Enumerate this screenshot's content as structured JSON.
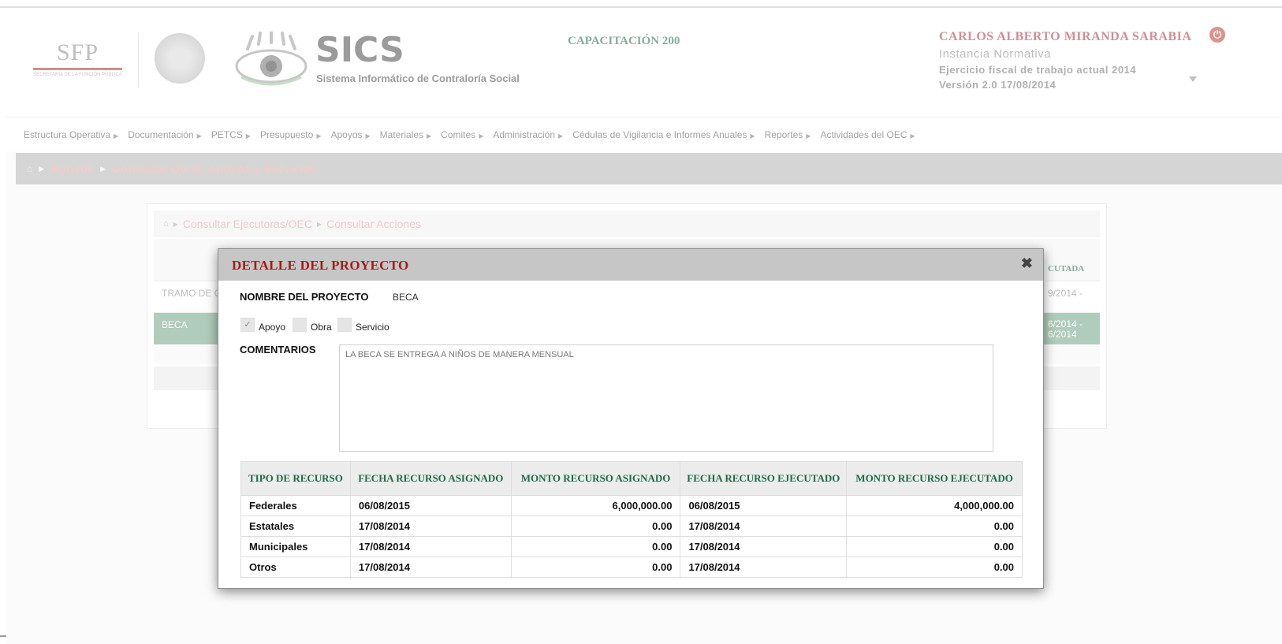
{
  "header": {
    "sfp_logo_text": "SFP",
    "sfp_logo_sub": "SECRETARÍA DE LA FUNCIÓN PÚBLICA",
    "app_name": "SICS",
    "app_subtitle": "Sistema Informático de Contraloría Social",
    "center_title": "CAPACITACIÓN 200",
    "user_name": "CARLOS ALBERTO MIRANDA SARABIA",
    "user_role": "Instancia Normativa",
    "fiscal_year": "Ejercicio fiscal de trabajo actual 2014",
    "version": "Versión 2.0    17/08/2014"
  },
  "nav": {
    "items": [
      "Estructura Operativa",
      "Documentación",
      "PETCS",
      "Presupuesto",
      "Apoyos",
      "Materiales",
      "Comites",
      "Administración",
      "Cédulas de Vigilancia e Informes Anuales",
      "Reportes",
      "Actividades del OEC"
    ]
  },
  "page_breadcrumb": [
    "Apoyos",
    "Consultar Obras Apoyos y Servicios"
  ],
  "card": {
    "breadcrumb": [
      "Consultar Ejecutoras/OEC",
      "Consultar Acciones"
    ],
    "partial_header": "CUTADA",
    "rows": [
      {
        "name": "TRAMO DE C",
        "date": "9/2014 -"
      },
      {
        "name": "BECA",
        "date": "6/2014 -",
        "date2": "6/2014"
      }
    ]
  },
  "modal": {
    "title": "DETALLE DEL PROYECTO",
    "project_name_label": "NOMBRE DEL PROYECTO",
    "project_name_value": "BECA",
    "checkboxes": [
      {
        "label": "Apoyo",
        "checked": true
      },
      {
        "label": "Obra",
        "checked": false
      },
      {
        "label": "Servicio",
        "checked": false
      }
    ],
    "comments_label": "COMENTARIOS",
    "comments_value": "LA BECA SE ENTREGA A NIÑOS DE MANERA MENSUAL",
    "table": {
      "headers": [
        "TIPO DE RECURSO",
        "FECHA RECURSO ASIGNADO",
        "MONTO RECURSO ASIGNADO",
        "FECHA RECURSO EJECUTADO",
        "MONTO RECURSO EJECUTADO"
      ],
      "rows": [
        [
          "Federales",
          "06/08/2015",
          "6,000,000.00",
          "06/08/2015",
          "4,000,000.00"
        ],
        [
          "Estatales",
          "17/08/2014",
          "0.00",
          "17/08/2014",
          "0.00"
        ],
        [
          "Municipales",
          "17/08/2014",
          "0.00",
          "17/08/2014",
          "0.00"
        ],
        [
          "Otros",
          "17/08/2014",
          "0.00",
          "17/08/2014",
          "0.00"
        ]
      ]
    }
  },
  "colors": {
    "accent_green": "#1e6b46",
    "accent_red": "#a31b1b",
    "selected_row": "#6fa386"
  }
}
